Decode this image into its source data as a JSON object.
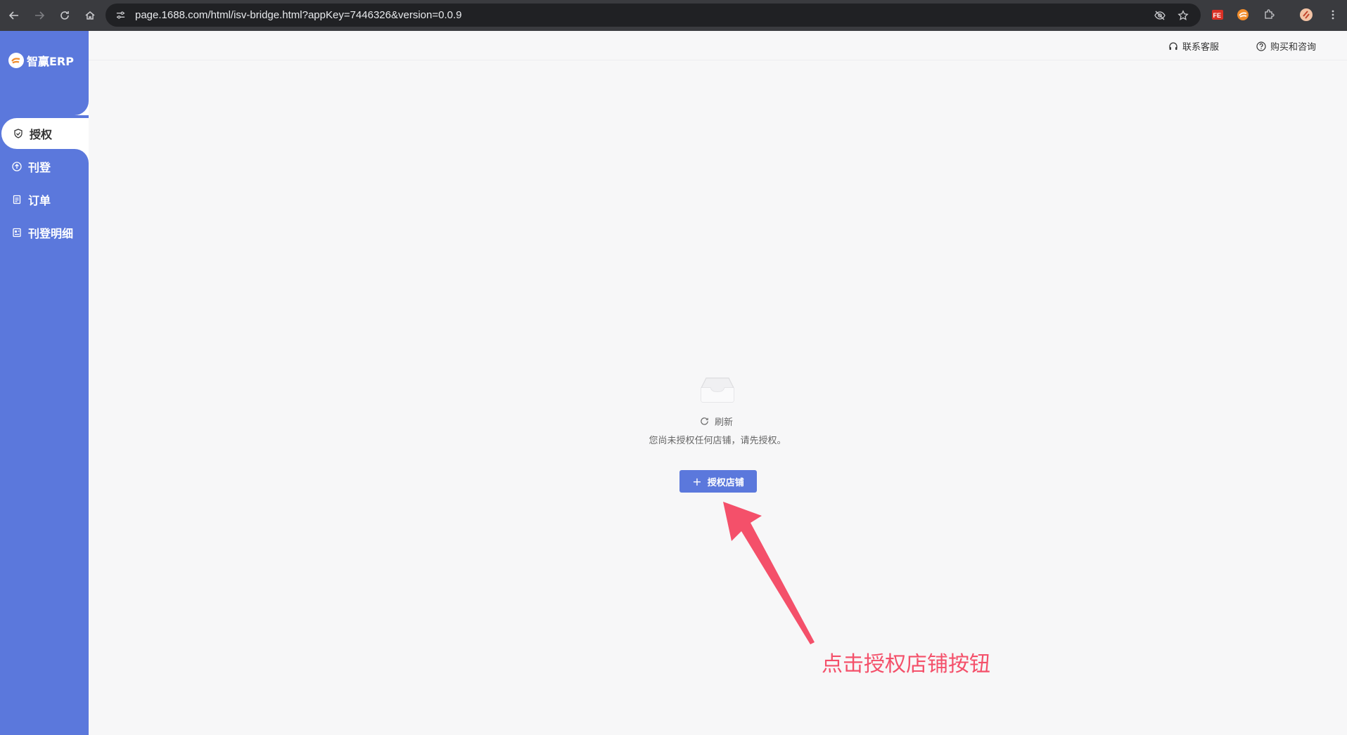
{
  "browser": {
    "url": "page.1688.com/html/isv-bridge.html?appKey=7446326&version=0.0.9",
    "icons": [
      "back-icon",
      "forward-icon",
      "reload-icon",
      "home-icon",
      "site-info-icon",
      "eye-off-icon",
      "star-icon",
      "extension-fe-icon",
      "extension-logo-icon",
      "puzzle-icon",
      "profile-icon",
      "kebab-menu-icon"
    ]
  },
  "sidebar": {
    "brand": "智赢ERP",
    "items": [
      {
        "label": "授权",
        "icon": "shield-icon",
        "active": true
      },
      {
        "label": "刊登",
        "icon": "upload-icon",
        "active": false
      },
      {
        "label": "订单",
        "icon": "document-icon",
        "active": false
      },
      {
        "label": "刊登明细",
        "icon": "detail-icon",
        "active": false
      }
    ]
  },
  "header": {
    "contact_label": "联系客服",
    "buy_label": "购买和咨询"
  },
  "main": {
    "refresh_label": "刷新",
    "empty_message": "您尚未授权任何店铺，请先授权。",
    "auth_button_label": "授权店铺"
  },
  "annotation": {
    "text": "点击授权店铺按钮",
    "color": "#f4506a"
  },
  "colors": {
    "brand": "#5b78dc",
    "background": "#f7f7f8",
    "browser_bar": "#3a3b3f"
  }
}
